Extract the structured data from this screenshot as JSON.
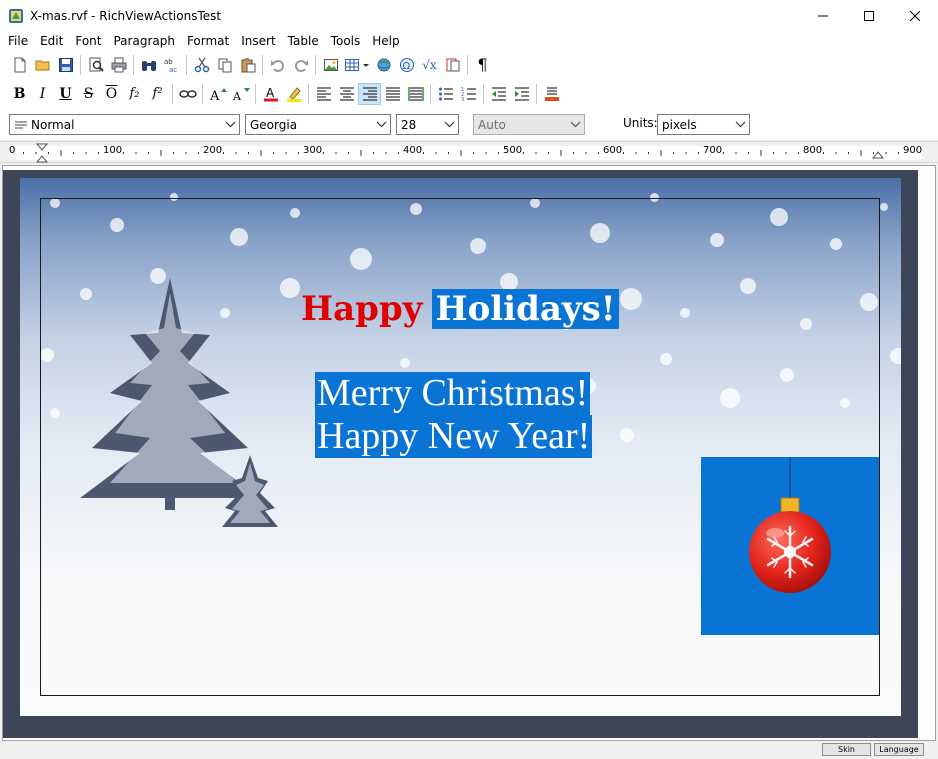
{
  "window": {
    "title": "X-mas.rvf - RichViewActionsTest"
  },
  "menu": [
    "File",
    "Edit",
    "Font",
    "Paragraph",
    "Format",
    "Insert",
    "Table",
    "Tools",
    "Help"
  ],
  "toolbar": {
    "bold": "B",
    "italic": "I",
    "underline": "U",
    "strikeout": "S",
    "overline": "O",
    "subscript": "f₂",
    "superscript": "f²",
    "pilcrow": "¶",
    "sqrt": "√x"
  },
  "format_bar": {
    "style_value": "Normal",
    "font_value": "Georgia",
    "size_value": "28",
    "color_value": "Auto",
    "units_label": "Units:",
    "units_value": "pixels"
  },
  "ruler": {
    "labels": [
      "0",
      "100",
      "200",
      "300",
      "400",
      "500",
      "600",
      "700",
      "800",
      "900"
    ]
  },
  "document": {
    "word_happy": "Happy",
    "word_holidays": "Holidays!",
    "line_merry": "Merry Christmas!",
    "line_newyear": "Happy New Year!"
  },
  "colors": {
    "selection": "#0a74d4",
    "happy_red": "#e00000",
    "editor_border": "#3c4656"
  },
  "status": {
    "skin_label": "Skin",
    "language_label": "Language"
  }
}
